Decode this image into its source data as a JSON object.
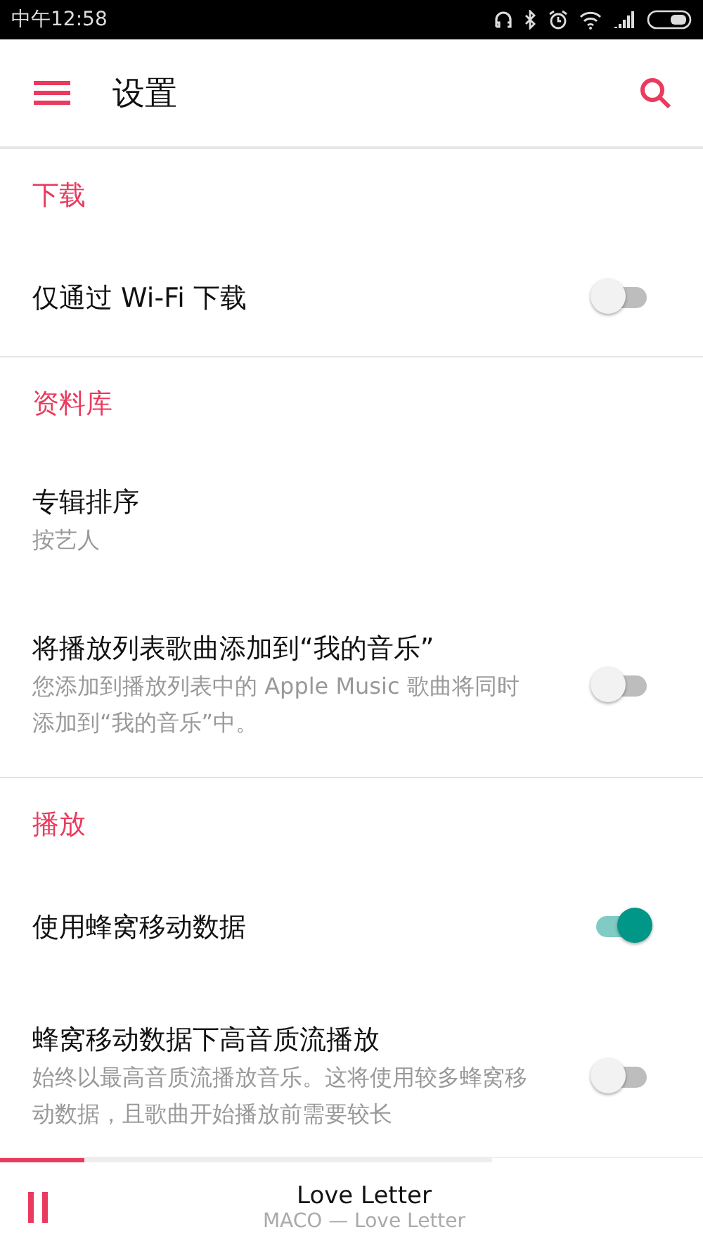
{
  "status_bar": {
    "time": "中午12:58"
  },
  "header": {
    "title": "设置"
  },
  "sections": [
    {
      "title": "下载",
      "items": [
        {
          "kind": "toggle",
          "label": "仅通过 Wi-Fi 下载",
          "on": false
        }
      ]
    },
    {
      "title": "资料库",
      "items": [
        {
          "kind": "value",
          "label": "专辑排序",
          "value": "按艺人"
        },
        {
          "kind": "toggle",
          "label": "将播放列表歌曲添加到“我的音乐”",
          "description": "您添加到播放列表中的 Apple Music 歌曲将同时添加到“我的音乐”中。",
          "on": false
        }
      ]
    },
    {
      "title": "播放",
      "items": [
        {
          "kind": "toggle",
          "label": "使用蜂窝移动数据",
          "on": true
        },
        {
          "kind": "toggle",
          "label": "蜂窝移动数据下高音质流播放",
          "description": "始终以最高音质流播放音乐。这将使用较多蜂窝移动数据，且歌曲开始播放前需要较长",
          "on": false
        }
      ]
    }
  ],
  "player": {
    "title": "Love Letter",
    "subtitle": "MACO — Love Letter",
    "level": 0.17
  }
}
